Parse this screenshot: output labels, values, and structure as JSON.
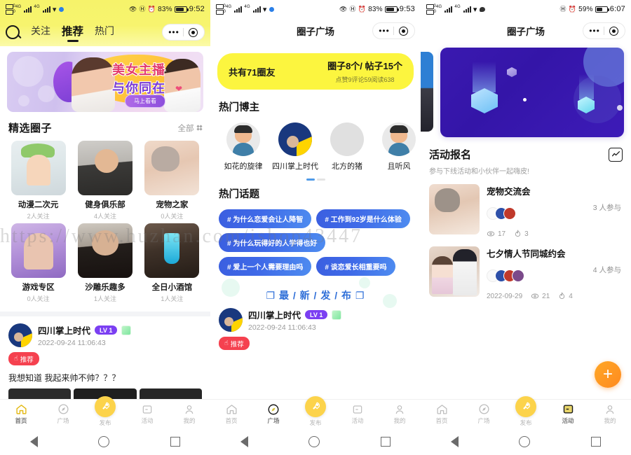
{
  "panel1": {
    "status": {
      "battery_pct": "83%",
      "time": "9:52"
    },
    "tabs": [
      {
        "label": "关注",
        "active": false
      },
      {
        "label": "推荐",
        "active": true
      },
      {
        "label": "热门",
        "active": false
      }
    ],
    "search_icon": "search-icon",
    "banner": {
      "line1": "美女主播",
      "line2": "与你同在",
      "button": "马上看看"
    },
    "section": {
      "title": "精选圈子",
      "more": "全部"
    },
    "circles": [
      {
        "name": "动漫二次元",
        "followers": "2人关注"
      },
      {
        "name": "健身俱乐部",
        "followers": "4人关注"
      },
      {
        "name": "宠物之家",
        "followers": "0人关注"
      },
      {
        "name": "游戏专区",
        "followers": "0人关注"
      },
      {
        "name": "沙雕乐趣多",
        "followers": "1人关注"
      },
      {
        "name": "全日小酒馆",
        "followers": "1人关注"
      }
    ],
    "feed": {
      "author": "四川掌上时代",
      "level": "LV 1",
      "time": "2022-09-24 11:06:43",
      "badge": "推荐",
      "text": "我想知道 我起来帅不帅？？？"
    }
  },
  "panel2": {
    "status": {
      "battery_pct": "83%",
      "time": "9:53"
    },
    "header_title": "圈子广场",
    "stat": {
      "members": "共有71圈友",
      "main": "圈子8个/ 帖子15个",
      "sub": "点赞9评论59阅读638"
    },
    "bloggers_title": "热门博主",
    "bloggers": [
      {
        "name": "如花的旋律"
      },
      {
        "name": "四川掌上时代"
      },
      {
        "name": "北方的猪"
      },
      {
        "name": "且听风"
      }
    ],
    "topics_title": "热门话题",
    "topics": [
      "# 为什么恋爱会让人降智",
      "# 工作到92岁是什么体验",
      "# 为什么玩得好的人学得也好",
      "# 爱上一个人需要理由吗",
      "# 谈恋爱长相重要吗"
    ],
    "newpub": "最 / 新 / 发 / 布",
    "feed": {
      "author": "四川掌上时代",
      "level": "LV 1",
      "time": "2022-09-24 11:06:43",
      "badge": "推荐"
    }
  },
  "panel3": {
    "status": {
      "battery_pct": "59%",
      "time": "6:07"
    },
    "header_title": "圈子广场",
    "activity": {
      "title": "活动报名",
      "subtitle": "参与下线活动和小伙伴一起嗨皮!",
      "chart_icon": "chart-line-icon"
    },
    "items": [
      {
        "title": "宠物交流会",
        "date": "",
        "views": "17",
        "likes": "3",
        "join": "3 人参与"
      },
      {
        "title": "七夕情人节同城约会",
        "date": "2022-09-29",
        "views": "21",
        "likes": "4",
        "join": "4 人参与"
      }
    ],
    "fab": "+"
  },
  "tabbar": {
    "items": [
      {
        "label": "首页",
        "icon": "home-icon"
      },
      {
        "label": "广场",
        "icon": "compass-icon"
      },
      {
        "label": "发布",
        "icon": "rocket-icon"
      },
      {
        "label": "活动",
        "icon": "activity-icon"
      },
      {
        "label": "我的",
        "icon": "person-icon"
      }
    ]
  },
  "watermark": {
    "url": "https://www.huzhan.com/ishop43447",
    "small": "www.huzhan.com"
  },
  "colors": {
    "brand_yellow": "#fcd34b",
    "header_yellow": "#f6f36a",
    "stat_yellow": "#fcf53f",
    "topic_blue": "#3f6ae8",
    "level_purple": "#7b3ff2",
    "badge_red": "#f5414f",
    "fab_orange": "#ff8a1f",
    "carousel_purple": "#3415a8"
  }
}
